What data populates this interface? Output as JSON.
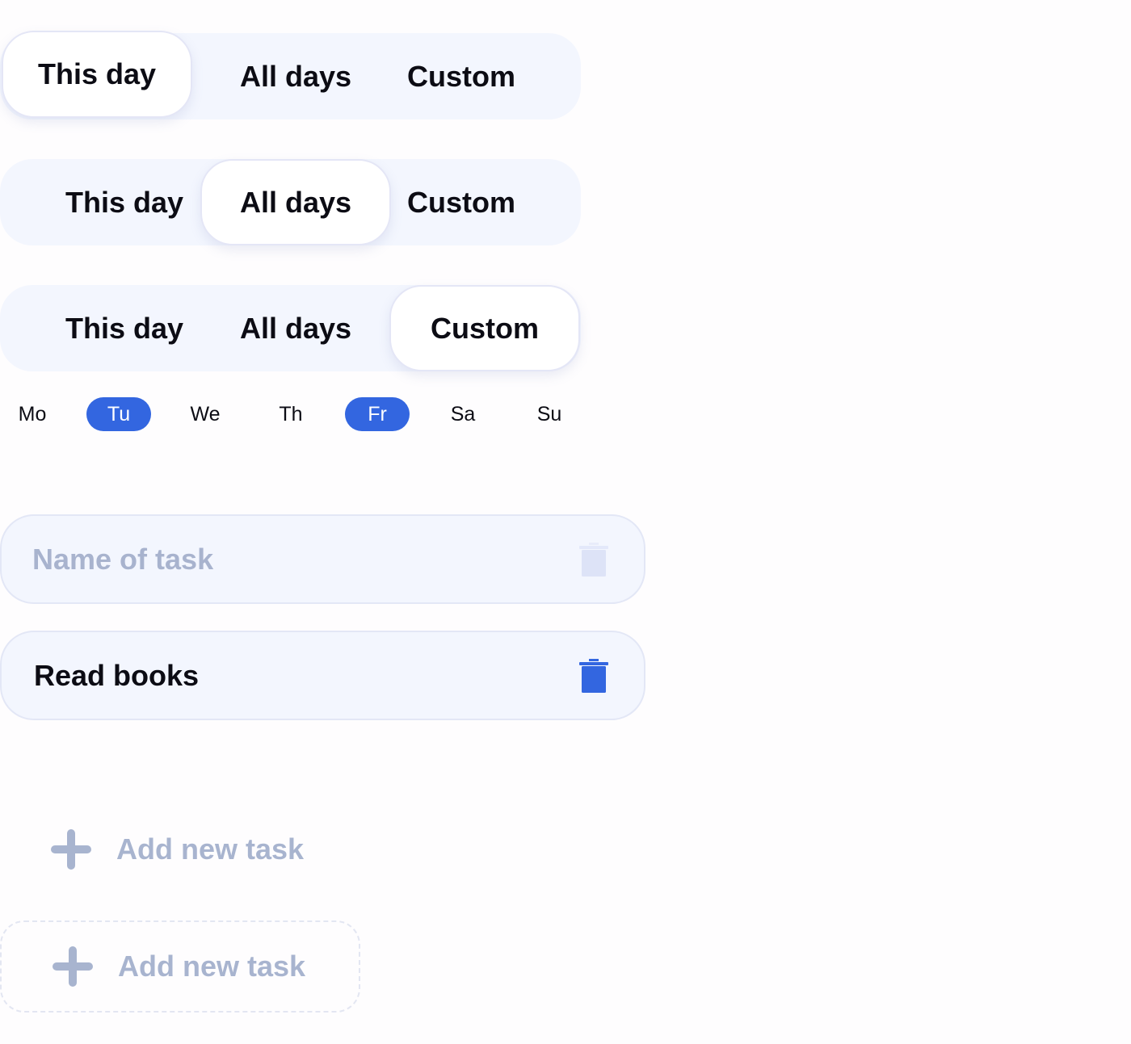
{
  "segmented_controls": [
    {
      "options": [
        "This day",
        "All days",
        "Custom"
      ],
      "selected": "This day"
    },
    {
      "options": [
        "This day",
        "All days",
        "Custom"
      ],
      "selected": "All days"
    },
    {
      "options": [
        "This day",
        "All days",
        "Custom"
      ],
      "selected": "Custom"
    }
  ],
  "weekdays": {
    "labels": [
      "Mo",
      "Tu",
      "We",
      "Th",
      "Fr",
      "Sa",
      "Su"
    ],
    "selected": [
      "Tu",
      "Fr"
    ]
  },
  "tasks": {
    "empty_placeholder": "Name of task",
    "filled_value": "Read books"
  },
  "add_task": {
    "label_plain": "Add new task",
    "label_dashed": "Add new task"
  },
  "colors": {
    "accent": "#3366e0",
    "muted": "#a8b4cf",
    "trash_disabled": "#dde3f7"
  }
}
